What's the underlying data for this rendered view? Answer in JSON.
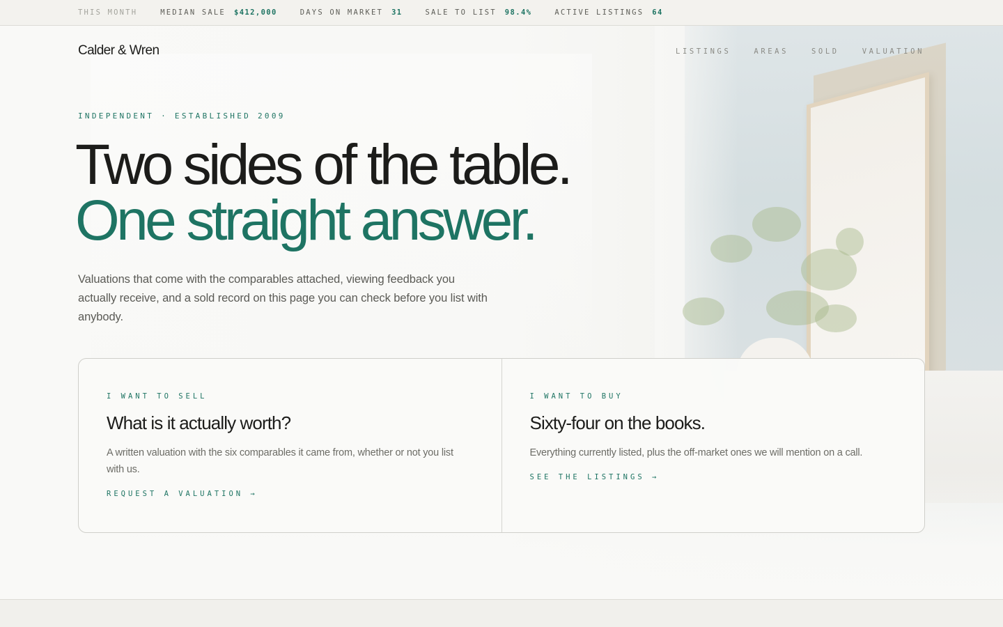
{
  "ticker": {
    "label": "This month",
    "stats": [
      {
        "key": "Median sale",
        "value": "$412,000"
      },
      {
        "key": "Days on market",
        "value": "31"
      },
      {
        "key": "Sale to list",
        "value": "98.4%"
      },
      {
        "key": "Active listings",
        "value": "64"
      }
    ]
  },
  "brand": {
    "name": "Calder & Wren"
  },
  "nav": {
    "items": [
      "Listings",
      "Areas",
      "Sold",
      "Valuation"
    ]
  },
  "hero": {
    "eyebrow": "Independent · Established 2009",
    "headline_1": "Two sides of the table.",
    "headline_2": "One straight answer.",
    "lede": "Valuations that come with the comparables attached, viewing feedback you actually receive, and a sold record on this page you can check before you list with anybody."
  },
  "cards": [
    {
      "tag": "I want to sell",
      "title": "What is it actually worth?",
      "body": "A written valuation with the six comparables it came from, whether or not you list with us.",
      "cta": "Request a valuation →"
    },
    {
      "tag": "I want to buy",
      "title": "Sixty-four on the books.",
      "body": "Everything currently listed, plus the off-market ones we will mention on a call.",
      "cta": "See the listings →"
    }
  ],
  "colors": {
    "accent": "#1e7463",
    "text": "#1c1c1a",
    "muted": "#6c6c66"
  }
}
